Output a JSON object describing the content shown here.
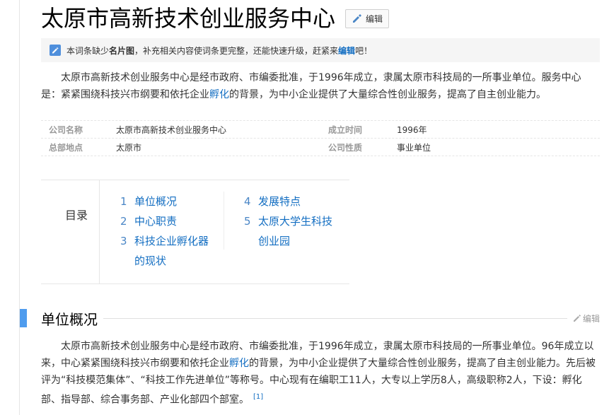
{
  "header": {
    "title": "太原市高新技术创业服务中心",
    "edit_label": "编辑"
  },
  "notice": {
    "text_before": "本词条缺少",
    "bold": "名片图",
    "text_middle": "，补充相关内容使词条更完整，还能快速升级，赶紧来",
    "link": "编辑",
    "text_after": "吧！"
  },
  "summary": {
    "text1": "太原市高新技术创业服务中心是经市政府、市编委批准，于1996年成立，隶属太原市科技局的一所事业单位。服务中心是：紧紧围绕科技兴市纲要和依托企业",
    "link": "孵化",
    "text2": "的背景，为中小企业提供了大量综合性创业服务，提高了自主创业能力。"
  },
  "basic_info": [
    {
      "key1": "公司名称",
      "val1": "太原市高新技术创业服务中心",
      "key2": "成立时间",
      "val2": "1996年"
    },
    {
      "key1": "总部地点",
      "val1": "太原市",
      "key2": "公司性质",
      "val2": "事业单位"
    }
  ],
  "toc": {
    "label": "目录",
    "items": [
      {
        "num": "1",
        "text": "单位概况"
      },
      {
        "num": "2",
        "text": "中心职责"
      },
      {
        "num": "3",
        "text": "科技企业孵化器的现状"
      },
      {
        "num": "4",
        "text": "发展特点"
      },
      {
        "num": "5",
        "text": "太原大学生科技创业园"
      }
    ]
  },
  "section1": {
    "title": "单位概况",
    "edit_label": "编辑",
    "text1": "太原市高新技术创业服务中心是经市政府、市编委批准，于1996年成立，隶属太原市科技局的一所事业单位。96年成立以来，中心紧紧围绕科技兴市纲要和依托企业",
    "link": "孵化",
    "text2": "的背景，为中小企业提供了大量综合性创业服务，提高了自主创业能力。先后被评为“科技模范集体”、“科技工作先进单位”等称号。中心现有在编职工11人，大专以上学历8人，高级职称2人，下设：孵化部、指导部、综合事务部、产业化部四个部室。",
    "ref": "[1]"
  },
  "colors": {
    "link": "#136ec2",
    "section_bar": "#4f9cee",
    "notice_bg": "#f5f5f5"
  }
}
